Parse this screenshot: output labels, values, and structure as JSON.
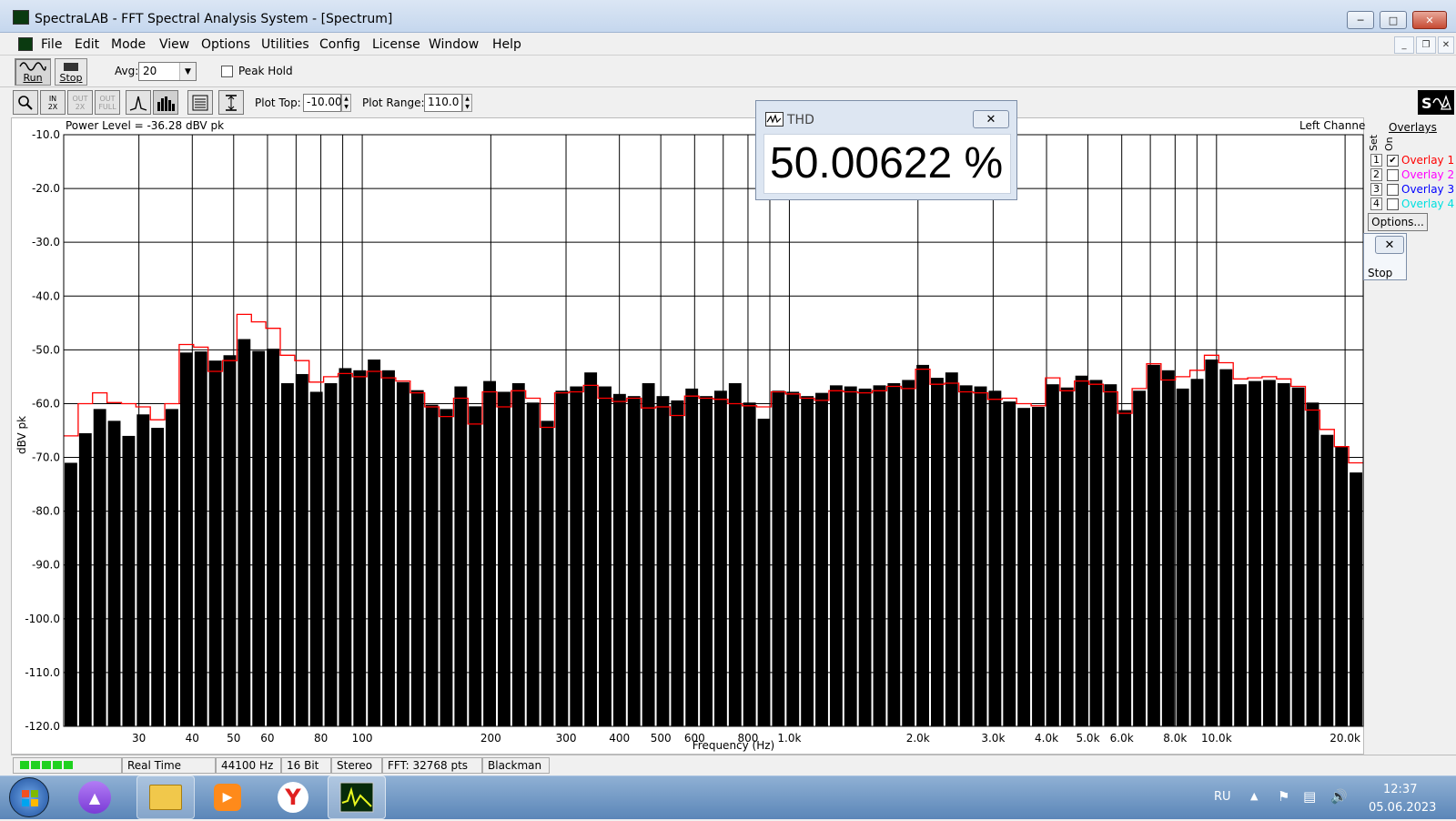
{
  "window": {
    "title": "SpectraLAB - FFT Spectral Analysis System - [Spectrum]"
  },
  "menu": [
    "File",
    "Edit",
    "Mode",
    "View",
    "Options",
    "Utilities",
    "Config",
    "License",
    "Window",
    "Help"
  ],
  "toolbar": {
    "run_label": "Run",
    "stop_label": "Stop",
    "avg_label": "Avg:",
    "avg_value": "20",
    "peak_hold_label": "Peak Hold",
    "plot_top_label": "Plot Top:",
    "plot_top_value": "-10.00",
    "plot_range_label": "Plot Range:",
    "plot_range_value": "110.0"
  },
  "plot": {
    "power_level": "Power Level = -36.28 dBV pk",
    "channel": "Left Channel"
  },
  "overlays": {
    "title": "Overlays",
    "set_label": "Set",
    "on_label": "On",
    "items": [
      {
        "num": "1",
        "name": "Overlay 1",
        "checked": true,
        "color": "#ff0000"
      },
      {
        "num": "2",
        "name": "Overlay 2",
        "checked": false,
        "color": "#ff00ff"
      },
      {
        "num": "3",
        "name": "Overlay 3",
        "checked": false,
        "color": "#0000ff"
      },
      {
        "num": "4",
        "name": "Overlay 4",
        "checked": false,
        "color": "#00e0e0"
      }
    ],
    "options_label": "Options..."
  },
  "thd": {
    "title": "THD",
    "value": "50.00622 %"
  },
  "mini_stop": {
    "label": "Stop"
  },
  "chart_data": {
    "type": "bar",
    "ylabel": "dBV pk",
    "xlabel": "Frequency (Hz)",
    "ylim": [
      -120,
      -10
    ],
    "xlim": [
      20,
      22050
    ],
    "xscale": "log",
    "yticks": [
      "-10.0",
      "-20.0",
      "-30.0",
      "-40.0",
      "-50.0",
      "-60.0",
      "-70.0",
      "-80.0",
      "-90.0",
      "-100.0",
      "-110.0",
      "-120.0"
    ],
    "xticks": [
      {
        "f": 30,
        "label": "30"
      },
      {
        "f": 40,
        "label": "40"
      },
      {
        "f": 50,
        "label": "50"
      },
      {
        "f": 60,
        "label": "60"
      },
      {
        "f": 80,
        "label": "80"
      },
      {
        "f": 100,
        "label": "100"
      },
      {
        "f": 200,
        "label": "200"
      },
      {
        "f": 300,
        "label": "300"
      },
      {
        "f": 400,
        "label": "400"
      },
      {
        "f": 500,
        "label": "500"
      },
      {
        "f": 600,
        "label": "600"
      },
      {
        "f": 800,
        "label": "800"
      },
      {
        "f": 1000,
        "label": "1.0k"
      },
      {
        "f": 2000,
        "label": "2.0k"
      },
      {
        "f": 3000,
        "label": "3.0k"
      },
      {
        "f": 4000,
        "label": "4.0k"
      },
      {
        "f": 5000,
        "label": "5.0k"
      },
      {
        "f": 6000,
        "label": "6.0k"
      },
      {
        "f": 8000,
        "label": "8.0k"
      },
      {
        "f": 10000,
        "label": "10.0k"
      },
      {
        "f": 20000,
        "label": "20.0k"
      }
    ],
    "grid": true,
    "series": [
      {
        "values": [
          -71.0,
          -65.5,
          -61.0,
          -63.2,
          -66.0,
          -62.0,
          -64.5,
          -61.0,
          -50.5,
          -50.3,
          -52.0,
          -51.0,
          -48.0,
          -50.2,
          -49.8,
          -56.2,
          -54.5,
          -57.8,
          -56.2,
          -53.4,
          -53.8,
          -51.8,
          -53.8,
          -56.0,
          -57.5,
          -60.2,
          -61.0,
          -56.8,
          -60.5,
          -55.8,
          -57.8,
          -56.2,
          -59.8,
          -63.2,
          -57.6,
          -56.8,
          -54.2,
          -56.8,
          -58.2,
          -58.6,
          -56.2,
          -58.6,
          -59.4,
          -57.2,
          -58.6,
          -57.6,
          -56.2,
          -59.8,
          -62.8,
          -57.6,
          -57.8,
          -58.6,
          -58.0,
          -56.6,
          -56.8,
          -57.2,
          -56.6,
          -56.2,
          -55.6,
          -52.8,
          -55.2,
          -54.2,
          -56.6,
          -56.8,
          -57.6,
          -59.6,
          -60.8,
          -60.6,
          -56.4,
          -57.0,
          -54.8,
          -55.6,
          -56.4,
          -61.2,
          -57.6,
          -52.8,
          -53.8,
          -57.2,
          -55.4,
          -51.8,
          -53.6,
          -56.4,
          -55.8,
          -55.6,
          -56.2,
          -57.0,
          -59.8,
          -65.8,
          -68.0,
          -72.8
        ]
      },
      {
        "name": "Overlay 1",
        "values": [
          -66.0,
          -60.0,
          -58.0,
          -59.8,
          -60.0,
          -60.6,
          -63.0,
          -60.0,
          -49.0,
          -49.5,
          -54.0,
          -52.0,
          -43.4,
          -44.8,
          -46.0,
          -51.0,
          -52.0,
          -56.0,
          -55.0,
          -54.4,
          -55.0,
          -54.0,
          -55.2,
          -55.8,
          -58.0,
          -60.6,
          -62.4,
          -59.0,
          -63.8,
          -57.8,
          -60.6,
          -57.6,
          -59.0,
          -64.4,
          -58.0,
          -57.8,
          -56.6,
          -59.0,
          -59.6,
          -59.0,
          -60.8,
          -60.6,
          -62.2,
          -58.6,
          -59.0,
          -59.2,
          -60.0,
          -60.4,
          -60.6,
          -57.8,
          -58.2,
          -59.0,
          -59.4,
          -57.6,
          -57.8,
          -58.0,
          -57.6,
          -56.8,
          -57.2,
          -53.6,
          -56.4,
          -56.2,
          -57.8,
          -58.0,
          -59.2,
          -59.0,
          -60.0,
          -60.4,
          -55.2,
          -57.6,
          -55.8,
          -56.4,
          -57.8,
          -61.8,
          -57.2,
          -52.6,
          -55.6,
          -55.0,
          -53.8,
          -51.0,
          -52.4,
          -55.4,
          -55.2,
          -55.0,
          -55.4,
          -56.8,
          -61.2,
          -64.8,
          -68.0,
          -71.0
        ]
      }
    ]
  },
  "status": {
    "mode": "Real Time",
    "rate": "44100 Hz",
    "bits": "16 Bit",
    "channels": "Stereo",
    "fft": "FFT: 32768 pts",
    "window": "Blackman"
  },
  "taskbar": {
    "lang": "RU",
    "time": "12:37",
    "date": "05.06.2023"
  }
}
